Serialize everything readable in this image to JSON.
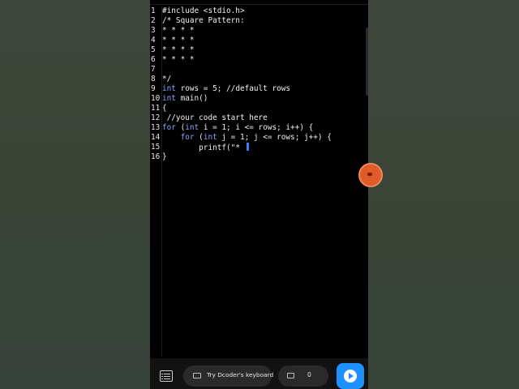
{
  "editor": {
    "lines": [
      {
        "n": "1",
        "parts": [
          {
            "t": "#include <stdio.h>",
            "c": "plain"
          }
        ]
      },
      {
        "n": "2",
        "parts": [
          {
            "t": "/* Square Pattern:",
            "c": "comment"
          }
        ]
      },
      {
        "n": "3",
        "parts": [
          {
            "t": "* * * *",
            "c": "comment"
          }
        ]
      },
      {
        "n": "4",
        "parts": [
          {
            "t": "* * * *",
            "c": "comment"
          }
        ]
      },
      {
        "n": "5",
        "parts": [
          {
            "t": "* * * *",
            "c": "comment"
          }
        ]
      },
      {
        "n": "6",
        "parts": [
          {
            "t": "* * * *",
            "c": "comment"
          }
        ]
      },
      {
        "n": "7",
        "parts": [
          {
            "t": "",
            "c": "plain"
          }
        ]
      },
      {
        "n": "8",
        "parts": [
          {
            "t": "*/",
            "c": "comment"
          }
        ]
      },
      {
        "n": "9",
        "parts": [
          {
            "t": "int",
            "c": "kw"
          },
          {
            "t": " rows = 5; ",
            "c": "plain"
          },
          {
            "t": "//default rows",
            "c": "comment"
          }
        ]
      },
      {
        "n": "10",
        "parts": [
          {
            "t": "int",
            "c": "kw"
          },
          {
            "t": " main()",
            "c": "plain"
          }
        ]
      },
      {
        "n": "11",
        "parts": [
          {
            "t": "{",
            "c": "plain"
          }
        ]
      },
      {
        "n": "12",
        "parts": [
          {
            "t": " //your code start here",
            "c": "comment"
          }
        ]
      },
      {
        "n": "13",
        "parts": [
          {
            "t": "for",
            "c": "kw"
          },
          {
            "t": " (",
            "c": "plain"
          },
          {
            "t": "int",
            "c": "kw"
          },
          {
            "t": " i = 1; i <= rows; i++) {",
            "c": "plain"
          }
        ]
      },
      {
        "n": "14",
        "parts": [
          {
            "t": "    for",
            "c": "kw"
          },
          {
            "t": " (",
            "c": "plain"
          },
          {
            "t": "int",
            "c": "kw"
          },
          {
            "t": " j = 1; j <= rows; j++) {",
            "c": "plain"
          }
        ]
      },
      {
        "n": "15",
        "parts": [
          {
            "t": "        printf(\"* ",
            "c": "plain"
          }
        ],
        "cursor": true
      },
      {
        "n": "16",
        "parts": [
          {
            "t": "}",
            "c": "plain"
          }
        ]
      }
    ]
  },
  "bottom_bar": {
    "keyboard_label": "Try Dcoder's keyboard",
    "comment_count": "0"
  },
  "colors": {
    "keyword": "#8fa0ff",
    "comment": "#8a9a8e",
    "run_button": "#1e90ff",
    "fab": "#e05a2a"
  },
  "icons": {
    "menu": "list-icon",
    "keyboard": "keyboard-icon",
    "comment": "comment-icon",
    "run": "play-icon",
    "floating": "floating-bubble-icon"
  }
}
